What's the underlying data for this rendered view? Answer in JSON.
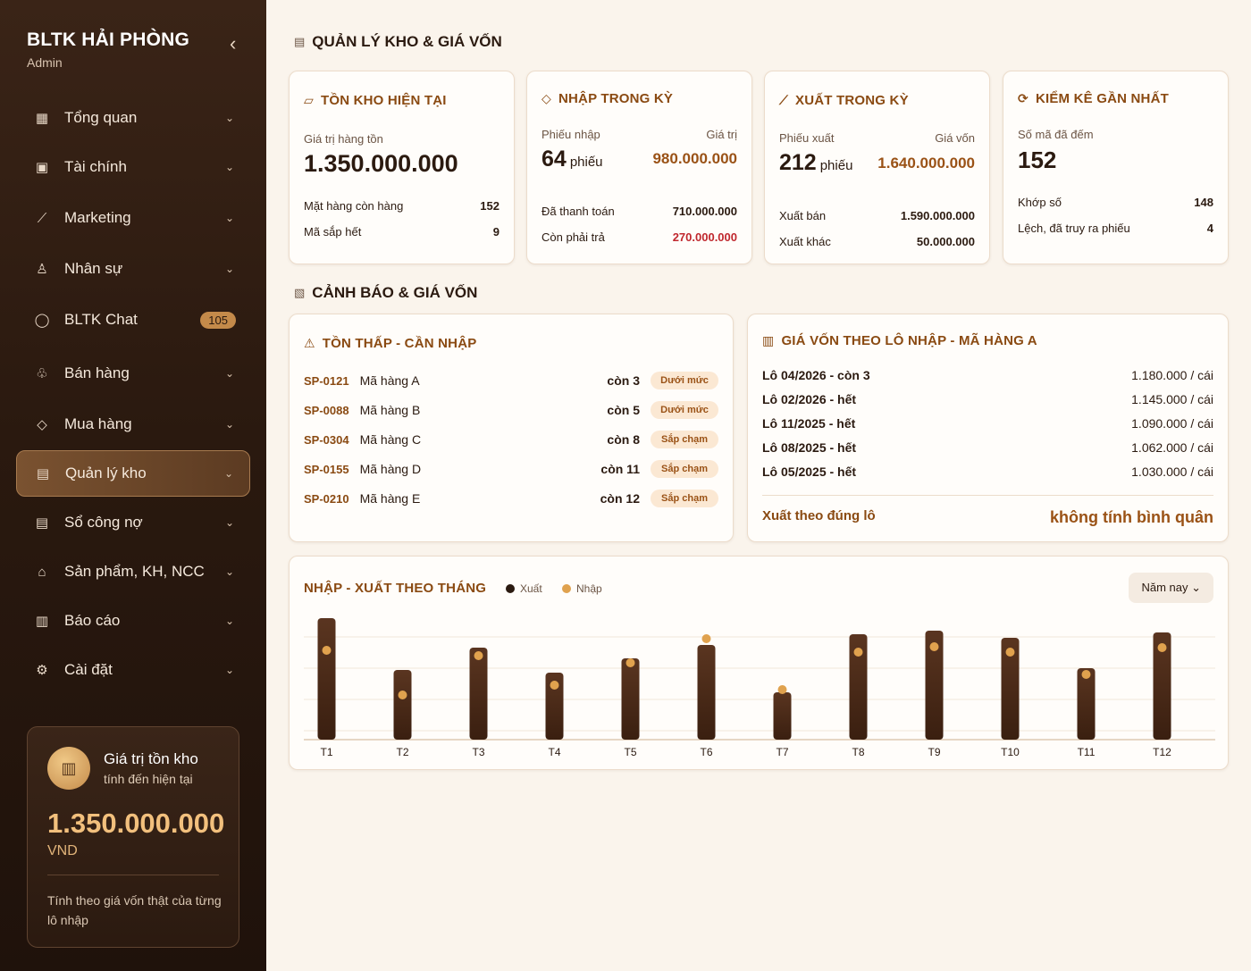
{
  "sidebar": {
    "brand": "BLTK HẢI PHÒNG",
    "role": "Admin",
    "collapse_icon": "‹",
    "items": [
      {
        "label": "Tổng quan",
        "icon": "▦",
        "chev": "⌄"
      },
      {
        "label": "Tài chính",
        "icon": "▣",
        "chev": "⌄"
      },
      {
        "label": "Marketing",
        "icon": "⟋",
        "chev": "⌄"
      },
      {
        "label": "Nhân sự",
        "icon": "♙",
        "chev": "⌄"
      },
      {
        "label": "BLTK Chat",
        "icon": "◯",
        "badge": "105"
      },
      {
        "label": "Bán hàng",
        "icon": "♧",
        "chev": "⌄"
      },
      {
        "label": "Mua hàng",
        "icon": "◇",
        "chev": "⌄"
      },
      {
        "label": "Quản lý kho",
        "icon": "▤",
        "chev": "⌄"
      },
      {
        "label": "Sổ công nợ",
        "icon": "▤",
        "chev": "⌄"
      },
      {
        "label": "Sản phẩm, KH, NCC",
        "icon": "⌂",
        "chev": "⌄"
      },
      {
        "label": "Báo cáo",
        "icon": "▥",
        "chev": "⌄"
      },
      {
        "label": "Cài đặt",
        "icon": "⚙",
        "chev": "⌄"
      }
    ],
    "stock_card": {
      "coin_icon": "▥",
      "title": "Giá trị tồn kho",
      "subtitle": "tính đến hiện tại",
      "value": "1.350.000.000",
      "unit": "VND",
      "note": "Tính theo giá vốn thật của từng lô nhập"
    }
  },
  "main": {
    "section1": {
      "icon": "▤",
      "title": "QUẢN LÝ KHO & GIÁ VỐN"
    },
    "kpi_stock": {
      "icon": "▱",
      "title": "TỒN KHO HIỆN TẠI",
      "label": "Giá trị hàng tồn",
      "value": "1.350.000.000",
      "rows": [
        {
          "label": "Mặt hàng còn hàng",
          "value": "152"
        },
        {
          "label": "Mã sắp hết",
          "value": "9"
        }
      ]
    },
    "kpi_import": {
      "icon": "◇",
      "title": "NHẬP TRONG KỲ",
      "label_left": "Phiếu nhập",
      "label_right": "Giá trị",
      "count": "64",
      "count_unit": "phiếu",
      "amount": "980.000.000",
      "rows": [
        {
          "label": "Đã thanh toán",
          "value": "710.000.000"
        },
        {
          "label": "Còn phải trả",
          "value": "270.000.000"
        }
      ]
    },
    "kpi_export": {
      "icon": "⟋",
      "title": "XUẤT TRONG KỲ",
      "label_left": "Phiếu xuất",
      "label_right": "Giá vốn",
      "count": "212",
      "count_unit": "phiếu",
      "amount": "1.640.000.000",
      "rows": [
        {
          "label": "Xuất bán",
          "value": "1.590.000.000"
        },
        {
          "label": "Xuất khác",
          "value": "50.000.000"
        }
      ]
    },
    "kpi_audit": {
      "icon": "⟳",
      "title": "KIỂM KÊ GẦN NHẤT",
      "label": "Số mã đã đếm",
      "value": "152",
      "rows": [
        {
          "label": "Khớp số",
          "value": "148"
        },
        {
          "label": "Lệch, đã truy ra phiếu",
          "value": "4"
        }
      ]
    },
    "section2": {
      "icon": "▧",
      "title": "CẢNH BÁO & GIÁ VỐN"
    },
    "low_stock": {
      "icon": "⚠",
      "title": "TỒN THẤP - CẦN NHẬP",
      "items": [
        {
          "code": "SP-0121",
          "name": "Mã hàng A",
          "qty": "còn 3",
          "status": "Dưới mức"
        },
        {
          "code": "SP-0088",
          "name": "Mã hàng B",
          "qty": "còn 5",
          "status": "Dưới mức"
        },
        {
          "code": "SP-0304",
          "name": "Mã hàng C",
          "qty": "còn 8",
          "status": "Sắp chạm"
        },
        {
          "code": "SP-0155",
          "name": "Mã hàng D",
          "qty": "còn 11",
          "status": "Sắp chạm"
        },
        {
          "code": "SP-0210",
          "name": "Mã hàng E",
          "qty": "còn 12",
          "status": "Sắp chạm"
        }
      ]
    },
    "lot_cost": {
      "icon": "▥",
      "title": "GIÁ VỐN THEO LÔ NHẬP - MÃ HÀNG A",
      "lots": [
        {
          "lot": "Lô 04/2026 - còn 3",
          "price": "1.180.000 / cái"
        },
        {
          "lot": "Lô 02/2026 - hết",
          "price": "1.145.000 / cái"
        },
        {
          "lot": "Lô 11/2025 - hết",
          "price": "1.090.000 / cái"
        },
        {
          "lot": "Lô 08/2025 - hết",
          "price": "1.062.000 / cái"
        },
        {
          "lot": "Lô 05/2025 - hết",
          "price": "1.030.000 / cái"
        }
      ],
      "footer_left": "Xuất theo đúng lô",
      "footer_right": "không tính bình quân"
    },
    "chart_card": {
      "title": "NHẬP - XUẤT THEO THÁNG",
      "selector": "Năm nay ⌄"
    }
  },
  "chart_data": {
    "type": "bar",
    "categories": [
      "T1",
      "T2",
      "T3",
      "T4",
      "T5",
      "T6",
      "T7",
      "T8",
      "T9",
      "T10",
      "T11",
      "T12"
    ],
    "series": [
      {
        "name": "Xuất",
        "values": [
          136,
          78,
          103,
          75,
          91,
          106,
          53,
          118,
          122,
          114,
          80,
          120
        ]
      },
      {
        "name": "Nhập",
        "values": [
          100,
          50,
          94,
          61,
          86,
          113,
          56,
          98,
          104,
          98,
          73,
          103
        ]
      }
    ],
    "ylim": [
      0,
      140
    ],
    "grid": true,
    "legend": "top-left",
    "colors": {
      "Xuất": "#3a1f10",
      "Nhập": "#e0a24e"
    }
  }
}
